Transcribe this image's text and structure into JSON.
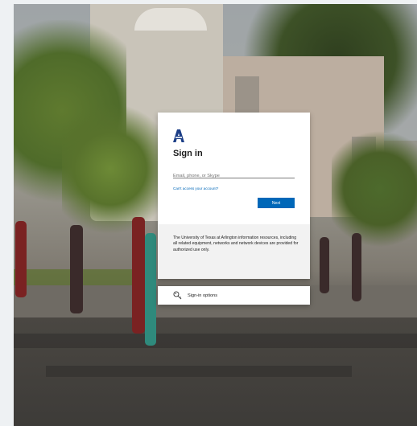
{
  "signin": {
    "title": "Sign in",
    "email_placeholder": "Email, phone, or Skype",
    "email_value": "",
    "cant_access_link": "Can't access your account?",
    "next_label": "Next",
    "footer_text": "The University of Texas at Arlington information resources, including all related equipment, networks and network devices are provided for authorized use only.",
    "logo_icon": "uta-a-logo-icon"
  },
  "signin_options": {
    "label": "Sign-in options",
    "icon": "key-icon"
  },
  "colors": {
    "accent": "#0067b8",
    "logo": "#1d3f87",
    "footer_bg": "#f2f2f2"
  }
}
